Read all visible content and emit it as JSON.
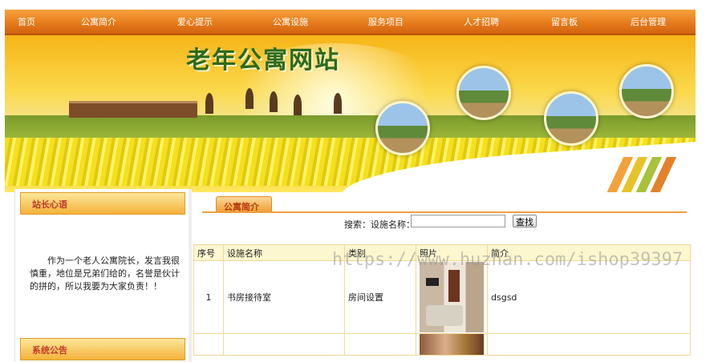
{
  "nav": {
    "items": [
      "首页",
      "公寓简介",
      "爱心提示",
      "公寓设施",
      "服务项目",
      "人才招聘",
      "留言板",
      "后台管理"
    ]
  },
  "banner": {
    "title": "老年公寓网站"
  },
  "sidebar": {
    "box1_title": "站长心语",
    "box1_text": "作为一个老人公寓院长，发言我很慎重，地位是兄弟们给的，名誉是伙计的拼的，所以我要为大家负责！！",
    "box2_title": "系统公告"
  },
  "main": {
    "tab_label": "公寓简介",
    "search_label": "搜索：设施名称：",
    "search_value": "",
    "search_button": "查找",
    "columns": [
      "序号",
      "设施名称",
      "类别",
      "照片",
      "简介"
    ],
    "rows": [
      {
        "no": "1",
        "name": "书房接待室",
        "category": "房间设置",
        "intro": "dsgsd"
      },
      {
        "no": "",
        "name": "",
        "category": "",
        "intro": ""
      }
    ]
  },
  "watermark": "https://www.huzhan.com/ishop39397",
  "colors": {
    "nav": "#e5791a",
    "accent": "#f29a2e",
    "title_red": "#c0392b",
    "header_bg": "#fdf7cf"
  }
}
